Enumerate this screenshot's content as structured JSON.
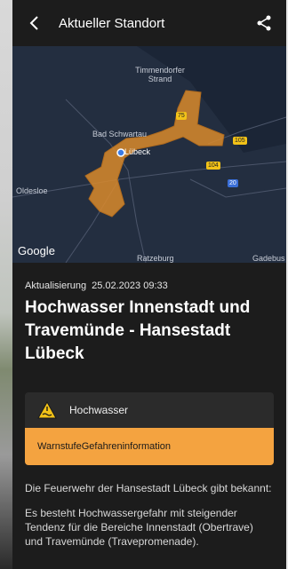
{
  "appbar": {
    "title": "Aktueller Standort",
    "back_icon": "back-arrow-icon",
    "share_icon": "share-icon"
  },
  "map": {
    "places": [
      "Timmendorfer Strand",
      "Bad Schwartau",
      "Lübeck",
      "Oldesloe",
      "Ratzeburg",
      "Gadebus"
    ],
    "roads": [
      "75",
      "105",
      "104",
      "20"
    ],
    "provider": "Google",
    "colors": {
      "area": "#d98a2b",
      "water": "#1f2a3c"
    }
  },
  "alert": {
    "updated_label": "Aktualisierung",
    "updated_value": "25.02.2023 09:33",
    "headline": "Hochwasser Innenstadt und Travemünde - Hansestadt Lübeck",
    "type": "Hochwasser",
    "level_label": "Warnstufe",
    "level_value": "Gefahreninformation",
    "colors": {
      "level": "#f4a340"
    },
    "paragraphs": [
      "Die Feuerwehr der Hansestadt Lübeck gibt bekannt:",
      "Es besteht Hochwassergefahr mit steigender Tendenz für die Bereiche Innenstadt (Obertrave) und Travemünde (Travepromenade)."
    ]
  }
}
